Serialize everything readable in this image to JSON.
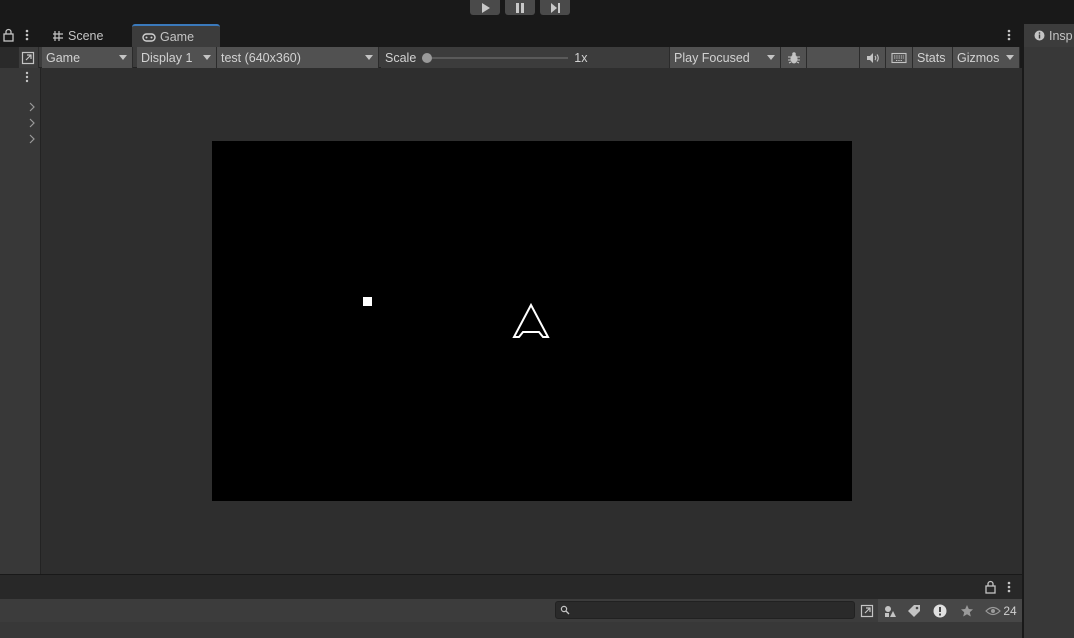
{
  "window_tabs": {
    "scene_label": "Scene",
    "game_label": "Game",
    "inspector_label": "Insp"
  },
  "play_controls": {
    "play_icon": "play-icon",
    "pause_icon": "pause-icon",
    "step_icon": "step-icon"
  },
  "game_toolbar": {
    "view_mode": "Game",
    "display": "Display 1",
    "resolution": "test (640x360)",
    "scale_label": "Scale",
    "scale_value": "1x",
    "scale_level": 0.0,
    "play_mode": "Play Focused",
    "stats_label": "Stats",
    "gizmos_label": "Gizmos"
  },
  "console": {
    "message_count": "24"
  },
  "colors": {
    "editor_bg": "#191919",
    "panel_bg": "#383838",
    "toolbar_bg": "#3c3c3c",
    "game_area_bg": "#2e2e2e",
    "game_view_bg": "#000000",
    "sprite_color": "#ffffff",
    "accent": "#3a79bb"
  }
}
